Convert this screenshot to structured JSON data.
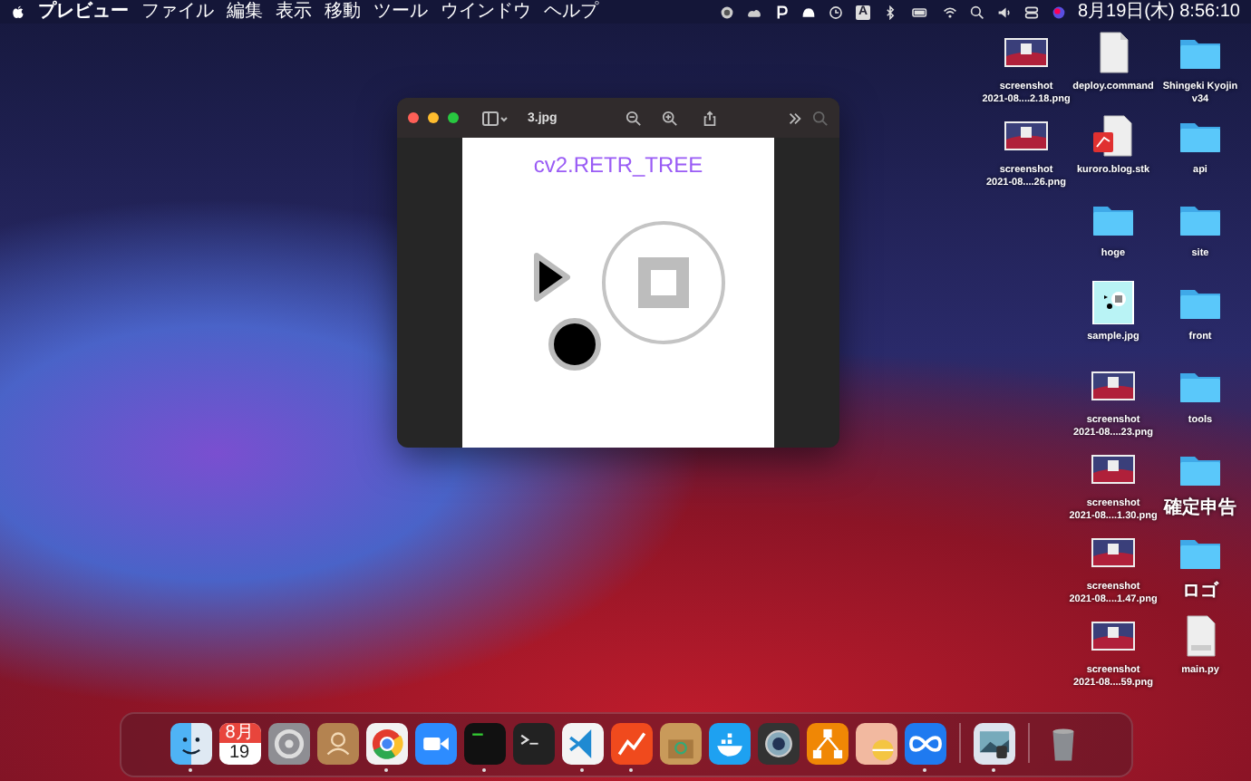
{
  "menu_bar": {
    "app_name": "プレビュー",
    "menus": [
      "ファイル",
      "編集",
      "表示",
      "移動",
      "ツール",
      "ウインドウ",
      "ヘルプ"
    ],
    "input_source": "A",
    "clock": "8月19日(木) 8:56:10"
  },
  "window": {
    "title": "3.jpg",
    "caption": "cv2.RETR_TREE"
  },
  "desktop_columns": [
    [
      {
        "kind": "screenshot",
        "name": "screenshot\n2021-08....2.18.png"
      },
      {
        "kind": "screenshot",
        "name": "screenshot\n2021-08....26.png"
      }
    ],
    [
      {
        "kind": "script",
        "name": "deploy.command"
      },
      {
        "kind": "stack",
        "name": "kuroro.blog.stk"
      },
      {
        "kind": "folder",
        "name": "hoge"
      },
      {
        "kind": "image",
        "name": "sample.jpg"
      },
      {
        "kind": "screenshot",
        "name": "screenshot\n2021-08....23.png"
      },
      {
        "kind": "screenshot",
        "name": "screenshot\n2021-08....1.30.png"
      },
      {
        "kind": "screenshot",
        "name": "screenshot\n2021-08....1.47.png"
      },
      {
        "kind": "screenshot",
        "name": "screenshot\n2021-08....59.png"
      }
    ],
    [
      {
        "kind": "folder",
        "name": "Shingeki Kyojin\nv34"
      },
      {
        "kind": "folder",
        "name": "api"
      },
      {
        "kind": "folder",
        "name": "site"
      },
      {
        "kind": "folder",
        "name": "front"
      },
      {
        "kind": "folder",
        "name": "tools"
      },
      {
        "kind": "folder",
        "name": "確定申告"
      },
      {
        "kind": "folder",
        "name": "ロゴ"
      },
      {
        "kind": "python",
        "name": "main.py"
      }
    ]
  ],
  "dock": {
    "items": [
      {
        "kind": "finder",
        "running": true
      },
      {
        "kind": "calendar",
        "running": false,
        "month": "8月",
        "day": "19"
      },
      {
        "kind": "gear",
        "running": false
      },
      {
        "kind": "contacts",
        "running": false
      },
      {
        "kind": "browser",
        "running": true
      },
      {
        "kind": "camera",
        "running": false
      },
      {
        "kind": "console",
        "running": true
      },
      {
        "kind": "terminal",
        "running": false
      },
      {
        "kind": "code",
        "running": true
      },
      {
        "kind": "chart",
        "running": true
      },
      {
        "kind": "box",
        "running": false
      },
      {
        "kind": "whale",
        "running": false
      },
      {
        "kind": "lens",
        "running": false
      },
      {
        "kind": "diagram",
        "running": false
      },
      {
        "kind": "pill",
        "running": false
      },
      {
        "kind": "infinity",
        "running": true
      },
      {
        "kind": "separator"
      },
      {
        "kind": "photo",
        "running": true
      },
      {
        "kind": "separator"
      },
      {
        "kind": "trash",
        "running": false
      }
    ]
  }
}
